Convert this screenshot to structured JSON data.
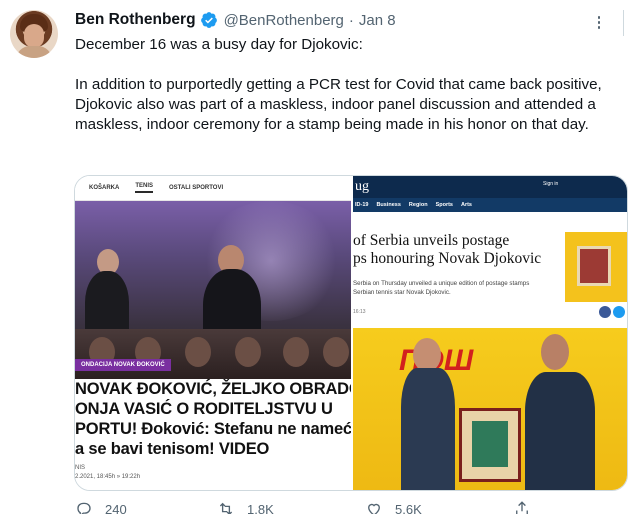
{
  "tweet": {
    "author_name": "Ben Rothenberg",
    "handle": "@BenRothenberg",
    "separator": "·",
    "date": "Jan 8",
    "text_lines_1": "December 16 was a busy day for Djokovic:",
    "text_lines_2": "In addition to purportedly getting a PCR test for Covid that came back positive, Djokovic also was part of a maskless, indoor panel discussion and attended a maskless, indoor ceremony for a stamp being made in his honor on that day."
  },
  "media_left": {
    "nav": [
      "KOŠARKA",
      "TENIS",
      "OSTALI SPORTOVI"
    ],
    "tag": "ONDACIJA NOVAK ĐOKOVIĆ",
    "headline_1": "NOVAK ĐOKOVIĆ, ŽELJKO OBRADOVIĆ",
    "headline_2": "ONJA VASIĆ O RODITELJSTVU U",
    "headline_3": "PORTU! Đoković: Stefanu ne nameće",
    "headline_4": "a se bavi tenisom! VIDEO",
    "meta_1": "NIS",
    "meta_2": "2.2021, 18:45h » 19:22h"
  },
  "media_right": {
    "logo": "ug",
    "sign": "Sign in",
    "nav": [
      "ID-19",
      "Business",
      "Region",
      "Sports",
      "Arts"
    ],
    "headline_1": "of Serbia unveils postage",
    "headline_2": "ps honouring Novak Djokovic",
    "lede_1": "Serbia on Thursday unveiled a unique edition of postage stamps",
    "lede_2": "Serbian tennis star Novak Djokovic.",
    "small": "16:13",
    "post_logo": "ПОШ"
  },
  "actions": {
    "reply_count": "240",
    "retweet_count": "1.8K",
    "like_count": "5.6K"
  },
  "colors": {
    "verified": "#1d9bf0",
    "secondary_text": "#536471",
    "border": "#cfd9de"
  }
}
